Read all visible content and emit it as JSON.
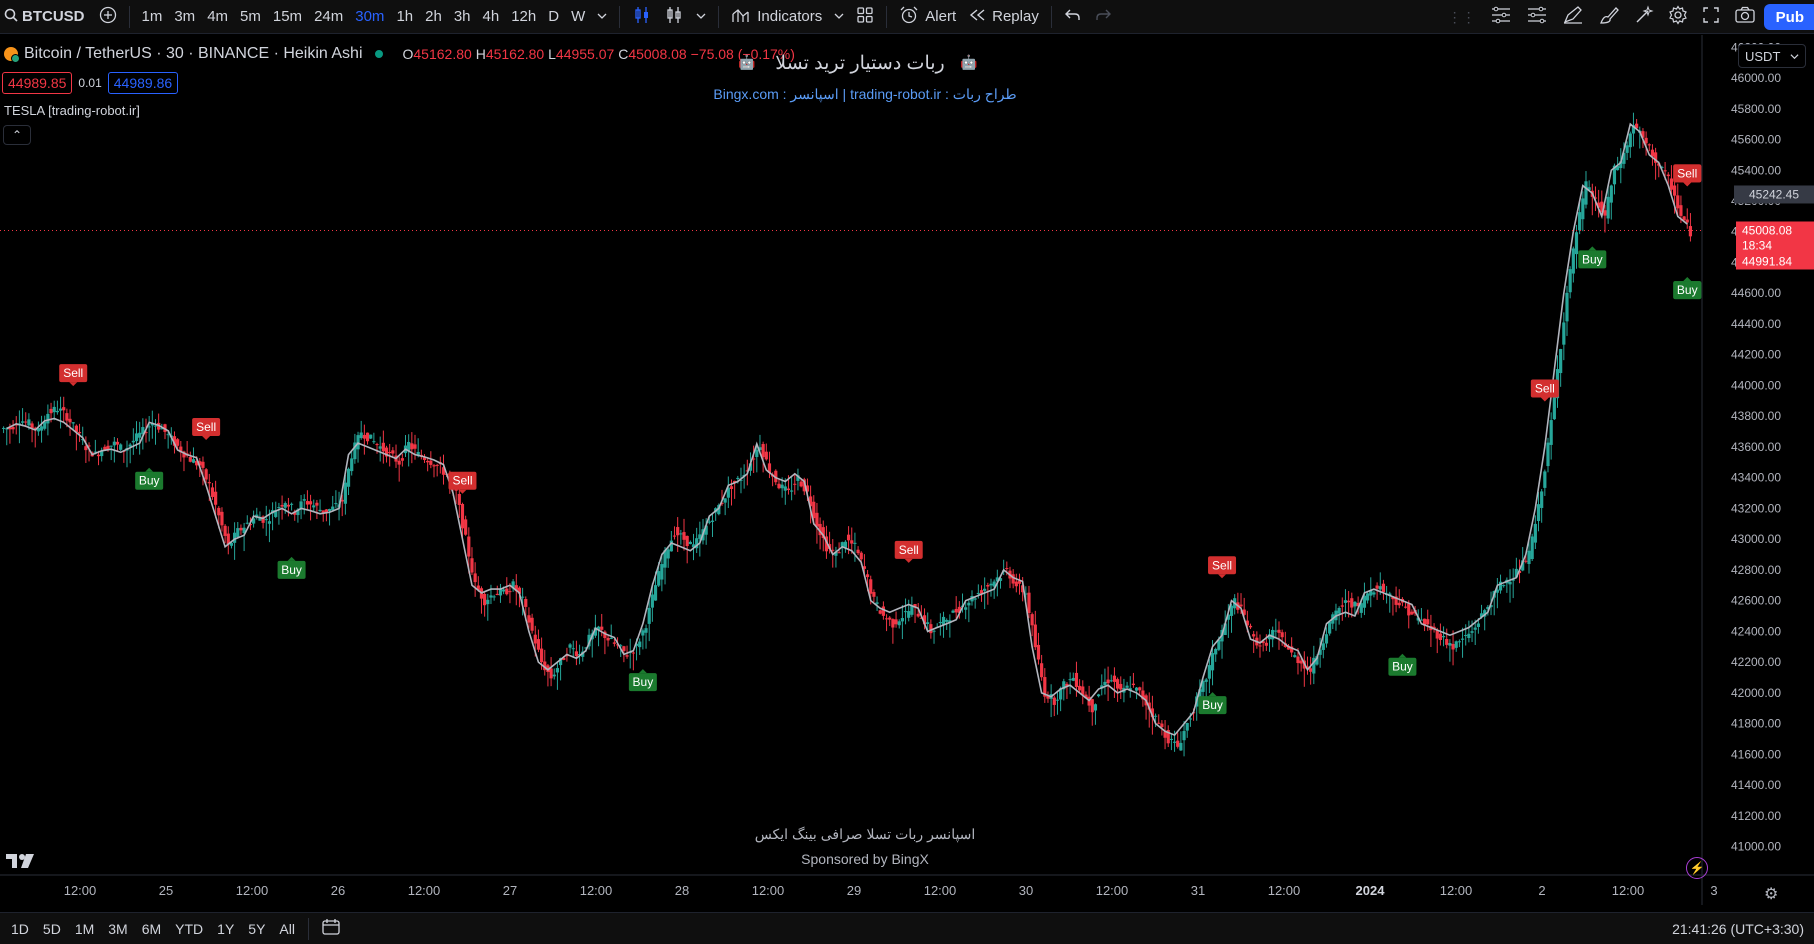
{
  "toolbar": {
    "symbol": "BTCUSD",
    "intervals": [
      "1m",
      "3m",
      "4m",
      "5m",
      "15m",
      "24m",
      "30m",
      "1h",
      "2h",
      "3h",
      "4h",
      "12h",
      "D",
      "W"
    ],
    "active_interval": "30m",
    "indicators_label": "Indicators",
    "alert_label": "Alert",
    "replay_label": "Replay",
    "publish_label": "Pub"
  },
  "legend": {
    "title": "Bitcoin / TetherUS · 30 · BINANCE · Heikin Ashi",
    "open_label": "O",
    "open": "45162.80",
    "high_label": "H",
    "high": "45162.80",
    "low_label": "L",
    "low": "44955.07",
    "close_label": "C",
    "close": "45008.08",
    "change": "−75.08 (−0.17%)"
  },
  "order_boxes": {
    "sell_price": "44989.85",
    "spread": "0.01",
    "buy_price": "44989.86"
  },
  "indicator": {
    "label": "TESLA [trading-robot.ir]"
  },
  "banner": {
    "title": "ربات دستیار ترید تسلا",
    "subtitle": "طراح ربات : trading-robot.ir    |    اسپانسر : Bingx.com"
  },
  "watermark": {
    "line1": "اسپانسر ربات تسلا صرافی بینگ ایکس",
    "line2": "Sponsored by BingX"
  },
  "price_scale": {
    "currency": "USDT",
    "ticks": [
      "46200.00",
      "46000.00",
      "45800.00",
      "45600.00",
      "45400.00",
      "45200.00",
      "45000.00",
      "44800.00",
      "44600.00",
      "44400.00",
      "44200.00",
      "44000.00",
      "43800.00",
      "43600.00",
      "43400.00",
      "43200.00",
      "43000.00",
      "42800.00",
      "42600.00",
      "42400.00",
      "42200.00",
      "42000.00",
      "41800.00",
      "41600.00",
      "41400.00",
      "41200.00",
      "41000.00"
    ],
    "crosshair_price": "45242.45",
    "last_price": "45008.08",
    "countdown": "18:34",
    "bid_price": "44991.84"
  },
  "time_axis": {
    "labels": [
      "12:00",
      "25",
      "12:00",
      "26",
      "12:00",
      "27",
      "12:00",
      "28",
      "12:00",
      "29",
      "12:00",
      "30",
      "12:00",
      "31",
      "12:00",
      "2024",
      "12:00",
      "2",
      "12:00",
      "3"
    ]
  },
  "bottombar": {
    "ranges": [
      "1D",
      "5D",
      "1M",
      "3M",
      "6M",
      "YTD",
      "1Y",
      "5Y",
      "All"
    ],
    "clock": "21:41:26 (UTC+3:30)"
  },
  "signals": {
    "sell_label": "Sell",
    "buy_label": "Buy",
    "points": [
      {
        "type": "sell",
        "i": 7
      },
      {
        "type": "buy",
        "i": 15
      },
      {
        "type": "sell",
        "i": 21
      },
      {
        "type": "buy",
        "i": 30
      },
      {
        "type": "sell",
        "i": 48
      },
      {
        "type": "buy",
        "i": 67
      },
      {
        "type": "sell",
        "i": 95
      },
      {
        "type": "sell",
        "i": 128
      },
      {
        "type": "buy",
        "i": 127
      },
      {
        "type": "buy",
        "i": 147
      },
      {
        "type": "sell",
        "i": 162
      },
      {
        "type": "buy",
        "i": 167
      },
      {
        "type": "sell",
        "i": 179
      },
      {
        "type": "buy",
        "i": 192
      },
      {
        "type": "sell",
        "i": 225
      },
      {
        "type": "buy",
        "i": 242
      }
    ]
  },
  "chart_data": {
    "type": "candlestick",
    "colors": {
      "up": "#26a69a",
      "down": "#f23645",
      "line": "#b2b5be"
    },
    "ylim": [
      40880,
      46280
    ],
    "closes": [
      43720,
      43780,
      43750,
      43700,
      43820,
      43850,
      43800,
      43700,
      43600,
      43550,
      43600,
      43620,
      43580,
      43640,
      43700,
      43760,
      43720,
      43650,
      43580,
      43520,
      43480,
      43350,
      43150,
      42950,
      43050,
      43100,
      43150,
      43120,
      43200,
      43250,
      43180,
      43250,
      43220,
      43180,
      43200,
      43250,
      43550,
      43700,
      43650,
      43600,
      43550,
      43500,
      43620,
      43550,
      43520,
      43480,
      43420,
      43300,
      43000,
      42700,
      42600,
      42650,
      42650,
      42700,
      42600,
      42400,
      42200,
      42100,
      42200,
      42300,
      42250,
      42350,
      42420,
      42350,
      42300,
      42250,
      42300,
      42450,
      42700,
      42900,
      43050,
      43000,
      42950,
      43050,
      43150,
      43250,
      43350,
      43400,
      43500,
      43620,
      43450,
      43350,
      43300,
      43400,
      43300,
      43100,
      42950,
      42900,
      43000,
      42950,
      42800,
      42600,
      42500,
      42450,
      42500,
      42550,
      42500,
      42400,
      42450,
      42500,
      42550,
      42600,
      42650,
      42700,
      42750,
      42800,
      42700,
      42650,
      42300,
      42000,
      41950,
      42050,
      42100,
      42000,
      41900,
      42050,
      42100,
      42000,
      42050,
      42000,
      41900,
      41800,
      41700,
      41650,
      41800,
      41950,
      42100,
      42300,
      42450,
      42600,
      42500,
      42350,
      42300,
      42400,
      42350,
      42250,
      42200,
      42150,
      42300,
      42450,
      42550,
      42600,
      42550,
      42650,
      42700,
      42650,
      42600,
      42550,
      42500,
      42450,
      42400,
      42350,
      42300,
      42350,
      42400,
      42500,
      42600,
      42700,
      42750,
      42800,
      42900,
      43200,
      43600,
      44100,
      44600,
      45000,
      45300,
      45200,
      45100,
      45400,
      45500,
      45700,
      45600,
      45500,
      45400,
      45300,
      45100,
      45000
    ]
  }
}
